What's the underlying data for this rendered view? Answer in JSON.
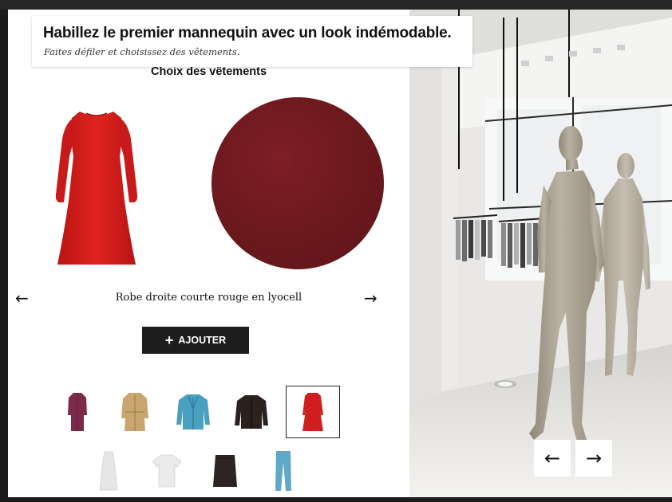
{
  "header": {
    "title": "Habillez le premier mannequin avec un look indémodable.",
    "subtitle": "Faites défiler et choisissez des vêtements."
  },
  "selector": {
    "section_title": "Choix des vêtements",
    "product_name": "Robe droite courte rouge en lyocell",
    "prev_arrow": "←",
    "next_arrow": "→",
    "add_button_icon": "+",
    "add_button_label": "AJOUTER",
    "swatch_color": "#6e1a1e"
  },
  "thumbnails": [
    {
      "name": "long-burgundy-coat",
      "color": "#7c2a4a"
    },
    {
      "name": "beige-trench-coat",
      "color": "#c9a570"
    },
    {
      "name": "blue-blazer",
      "color": "#4aa0c0"
    },
    {
      "name": "black-leather-jacket",
      "color": "#2b2220"
    },
    {
      "name": "red-dress",
      "color": "#d01e1e",
      "selected": true
    },
    {
      "name": "white-dress",
      "color": "#ececec"
    },
    {
      "name": "white-tshirt",
      "color": "#ebebeb"
    },
    {
      "name": "black-skirt",
      "color": "#2c2422"
    },
    {
      "name": "blue-jeans",
      "color": "#5fa8c6"
    }
  ],
  "scene": {
    "prev_label": "←",
    "next_label": "→"
  }
}
